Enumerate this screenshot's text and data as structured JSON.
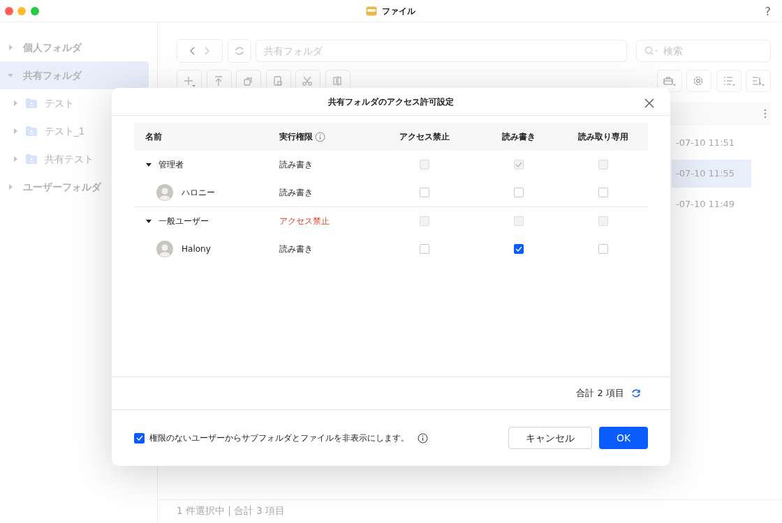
{
  "window": {
    "title": "ファイル",
    "help": "?"
  },
  "sidebar": {
    "items": [
      {
        "label": "個人フォルダ",
        "expanded": false,
        "selected": false
      },
      {
        "label": "共有フォルダ",
        "expanded": true,
        "selected": true,
        "children": [
          {
            "label": "テスト",
            "expanded": false,
            "selected": false
          },
          {
            "label": "テスト_1",
            "expanded": false,
            "selected": false
          },
          {
            "label": "共有テスト",
            "expanded": false,
            "selected": false
          }
        ]
      },
      {
        "label": "ユーザーフォルダ",
        "expanded": false,
        "selected": false
      }
    ]
  },
  "toolbar": {
    "path_field": {
      "value": "共有フォルダ"
    },
    "search": {
      "placeholder": "検索"
    }
  },
  "file_rows": [
    {
      "column_3": "-07-10 11:51",
      "selected": false
    },
    {
      "column_3": "-07-10 11:55",
      "selected": true
    },
    {
      "column_3": "-07-10 11:49",
      "selected": false
    }
  ],
  "status_bar": "1 件選択中 | 合計 3 項目",
  "dialog": {
    "title": "共有フォルダのアクセス許可設定",
    "columns": [
      "名前",
      "実行権限",
      "アクセス禁止",
      "読み書き",
      "読み取り専用"
    ],
    "groups": [
      {
        "name": "管理者",
        "expanded": true,
        "permission": "読み書き",
        "denied": false,
        "checks": [
          {
            "checked": false,
            "disabled": true
          },
          {
            "checked": true,
            "disabled": true
          },
          {
            "checked": false,
            "disabled": true
          }
        ],
        "members": [
          {
            "name": "ハロニー",
            "permission": "読み書き",
            "denied": false,
            "checks": [
              {
                "checked": false,
                "disabled": false
              },
              {
                "checked": false,
                "disabled": false
              },
              {
                "checked": false,
                "disabled": false
              }
            ]
          }
        ]
      },
      {
        "name": "一般ユーザー",
        "expanded": true,
        "permission": "アクセス禁止",
        "denied": true,
        "checks": [
          {
            "checked": false,
            "disabled": true
          },
          {
            "checked": false,
            "disabled": true
          },
          {
            "checked": false,
            "disabled": true
          }
        ],
        "members": [
          {
            "name": "Halony",
            "permission": "読み書き",
            "denied": false,
            "checks": [
              {
                "checked": false,
                "disabled": false
              },
              {
                "checked": true,
                "disabled": false
              },
              {
                "checked": false,
                "disabled": false
              }
            ]
          }
        ]
      }
    ],
    "total": "合計 2 項目",
    "hide_option": {
      "label": "権限のないユーザーからサブフォルダとファイルを非表示にします。",
      "checked": true
    },
    "buttons": {
      "cancel": "キャンセル",
      "ok": "OK"
    }
  }
}
